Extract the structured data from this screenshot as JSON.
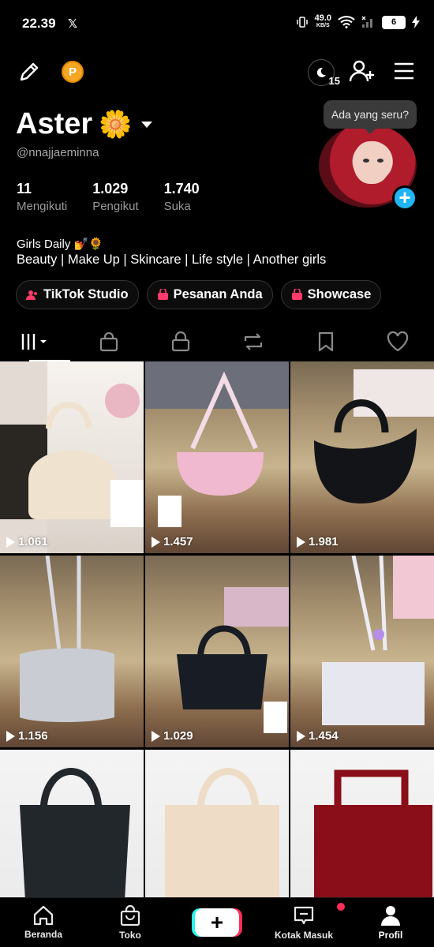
{
  "status_bar": {
    "time": "22.39",
    "x_icon": "𝕏",
    "net_speed": "49.0",
    "net_unit": "KB/S",
    "battery": "6"
  },
  "profile": {
    "name": "Aster",
    "name_emoji": "🌼",
    "handle": "@nnajjaeminna",
    "coin_label": "P",
    "badge_count": "15",
    "tooltip": "Ada yang seru?",
    "stats": [
      {
        "value": "11",
        "label": "Mengikuti"
      },
      {
        "value": "1.029",
        "label": "Pengikut"
      },
      {
        "value": "1.740",
        "label": "Suka"
      }
    ],
    "bio_line1": "Girls Daily 💅🌻",
    "bio_line2": "Beauty | Make Up | Skincare | Life style | Another girls"
  },
  "pills": [
    {
      "label": "TikTok Studio",
      "icon": "people-icon"
    },
    {
      "label": "Pesanan Anda",
      "icon": "bag-icon"
    },
    {
      "label": "Showcase",
      "icon": "bag-icon"
    }
  ],
  "tabs": [
    "grid-icon",
    "shop-bag-icon",
    "lock-icon",
    "repost-icon",
    "bookmark-icon",
    "heart-icon"
  ],
  "videos": [
    {
      "views": "1.061",
      "bag_color": "#efe3cf",
      "bg": "bg-studio"
    },
    {
      "views": "1.457",
      "bag_color": "#f0b9cf",
      "bg": "bg-building"
    },
    {
      "views": "1.981",
      "bag_color": "#121418",
      "bg": "bg-building"
    },
    {
      "views": "1.156",
      "bag_color": "#c9ccd3",
      "bg": "bg-building"
    },
    {
      "views": "1.029",
      "bag_color": "#181c24",
      "bg": "bg-building"
    },
    {
      "views": "1.454",
      "bag_color": "#e7e7ef",
      "bg": "bg-building"
    },
    {
      "views": "",
      "bag_color": "#22272c",
      "bg": "bg-white"
    },
    {
      "views": "",
      "bag_color": "#efdcc6",
      "bg": "bg-white"
    },
    {
      "views": "",
      "bag_color": "#8a0d1a",
      "bg": "bg-white"
    }
  ],
  "bottom_nav": [
    {
      "label": "Beranda",
      "icon": "home-icon"
    },
    {
      "label": "Toko",
      "icon": "shop-icon"
    },
    {
      "label": "",
      "icon": "create-icon"
    },
    {
      "label": "Kotak Masuk",
      "icon": "inbox-icon"
    },
    {
      "label": "Profil",
      "icon": "profile-icon"
    }
  ],
  "plus_glyph": "+"
}
